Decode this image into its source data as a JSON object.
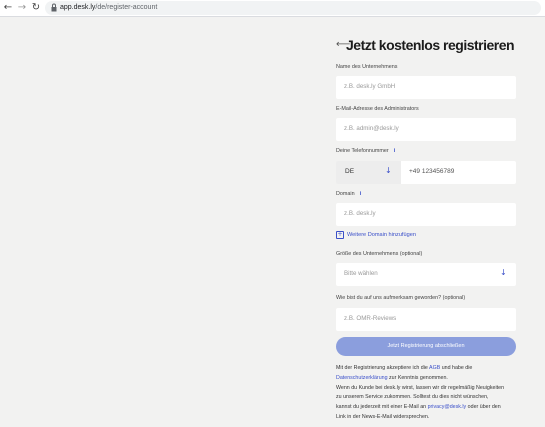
{
  "browser": {
    "url_host": "app.desk.ly",
    "url_path": "/de/register-account",
    "back_icon": "arrow-left-icon",
    "forward_icon": "arrow-right-icon",
    "reload_icon": "reload-icon"
  },
  "form": {
    "title": "Jetzt kostenlos registrieren",
    "company": {
      "label": "Name des Unternehmens",
      "placeholder": "z.B. desk.ly GmbH"
    },
    "email": {
      "label": "E-Mail-Adresse des Administrators",
      "placeholder": "z.B. admin@desk.ly"
    },
    "phone": {
      "label": "Deine Telefonnummer",
      "country": "DE",
      "placeholder": "+49 123456789"
    },
    "domain": {
      "label": "Domain",
      "placeholder": "z.B. desk.ly"
    },
    "add_domain": "Weitere Domain hinzufügen",
    "size": {
      "label": "Größe des Unternehmens (optional)",
      "placeholder": "Bitte wählen"
    },
    "referral": {
      "label": "Wie bist du auf uns aufmerksam geworden? (optional)",
      "placeholder": "z.B. OMR-Reviews"
    },
    "submit": "Jetzt Registrierung abschließen",
    "legal": {
      "t1": "Mit der Registrierung akzeptiere ich die ",
      "agb": "AGB",
      "t2": " und habe die",
      "privacy_link": "Datenschutzerklärung",
      "t3": " zur Kenntnis genommen.",
      "line3": "Wenn du Kunde bei desk.ly wirst, lassen wir dir regelmäßig Neuigkeiten",
      "line4": "zu unserem Service zukommen. Solltest du dies nicht wünschen,",
      "t5": "kannst du jederzeit mit einer E-Mail an ",
      "email_link": "privacy@desk.ly",
      "t6": " oder über den",
      "line6": "Link in der News-E-Mail widersprechen."
    }
  },
  "colors": {
    "accent": "#3a4fc9",
    "button": "#8b9edd",
    "background": "#f2f2f1"
  }
}
